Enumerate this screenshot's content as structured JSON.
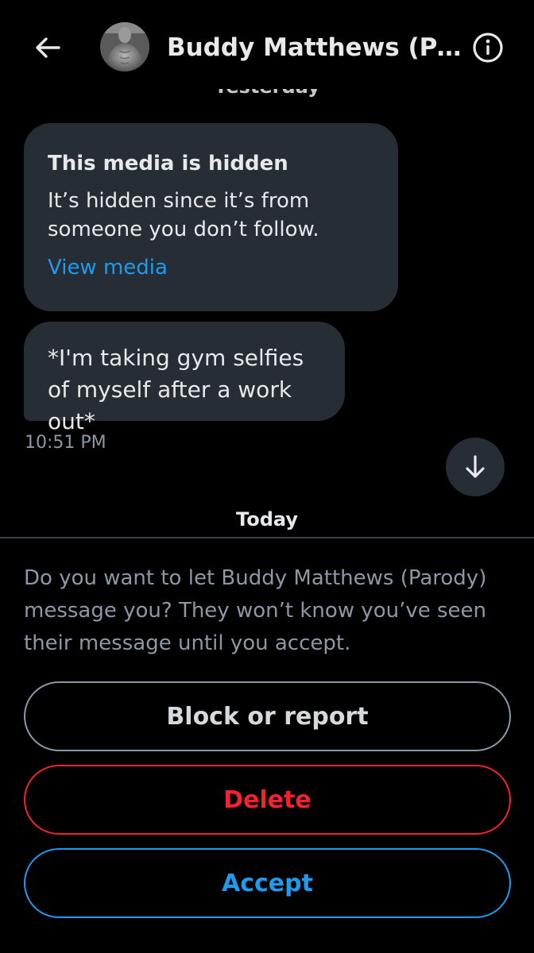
{
  "header": {
    "title": "Buddy Matthews (Pa...",
    "back_icon": "arrow-left-icon",
    "info_icon": "info-circle-icon"
  },
  "conversation": {
    "day_label_yesterday": "Yesterday",
    "hidden_media": {
      "title": "This media is hidden",
      "body": "It’s hidden since it’s from someone you don’t follow.",
      "link": "View media"
    },
    "message_text": "*I'm taking gym selfies of myself after a work out*",
    "timestamp": "10:51 PM",
    "scroll_down_icon": "arrow-down-icon",
    "day_label_today": "Today"
  },
  "request": {
    "prompt": "Do you want to let Buddy Matthews (Parody) message you? They won’t know you’ve seen their message until you accept.",
    "block_label": "Block or report",
    "delete_label": "Delete",
    "accept_label": "Accept"
  },
  "colors": {
    "background": "#000000",
    "bubble": "#262d34",
    "link_blue": "#1d9bf0",
    "danger_red": "#f4212e",
    "muted_text": "#8b98a5"
  }
}
